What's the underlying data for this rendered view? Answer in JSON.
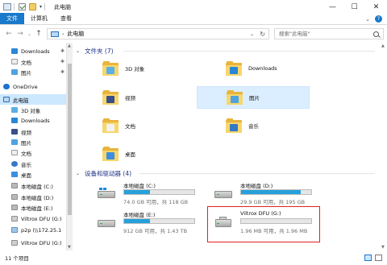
{
  "window": {
    "title": "此电脑",
    "minimize": "—",
    "maximize": "☐",
    "close": "✕"
  },
  "ribbon": {
    "file_tab": "文件",
    "tabs": [
      "计算机",
      "查看"
    ],
    "expand_chevron": "⌄",
    "help": "?"
  },
  "address": {
    "path": "此电脑",
    "separator": "›",
    "dropdown": "⌄",
    "refresh": "↻",
    "back": "←",
    "forward": "→",
    "recent": "⌄",
    "up": "↑"
  },
  "search": {
    "placeholder": "搜索\"此电脑\""
  },
  "nav_pane": {
    "items": [
      {
        "label": "Downloads",
        "pinned": true,
        "icon": "download-icon"
      },
      {
        "label": "文档",
        "pinned": true,
        "icon": "document-icon"
      },
      {
        "label": "图片",
        "pinned": true,
        "icon": "pictures-icon"
      },
      {
        "label": "OneDrive",
        "pinned": false,
        "icon": "onedrive-icon"
      },
      {
        "label": "此电脑",
        "pinned": false,
        "icon": "pc-icon",
        "selected": true
      },
      {
        "label": "3D 对象",
        "pinned": false,
        "icon": "3d-objects-icon"
      },
      {
        "label": "Downloads",
        "pinned": false,
        "icon": "download-icon"
      },
      {
        "label": "视频",
        "pinned": false,
        "icon": "video-icon"
      },
      {
        "label": "图片",
        "pinned": false,
        "icon": "pictures-icon"
      },
      {
        "label": "文档",
        "pinned": false,
        "icon": "document-icon"
      },
      {
        "label": "音乐",
        "pinned": false,
        "icon": "music-icon"
      },
      {
        "label": "桌面",
        "pinned": false,
        "icon": "desktop-icon"
      },
      {
        "label": "本地磁盘 (C:)",
        "pinned": false,
        "icon": "drive-icon"
      },
      {
        "label": "本地磁盘 (D:)",
        "pinned": false,
        "icon": "drive-icon"
      },
      {
        "label": "本地磁盘 (E:)",
        "pinned": false,
        "icon": "drive-icon"
      },
      {
        "label": "Viltrox DFU (G:)",
        "pinned": false,
        "icon": "usb-drive-icon"
      },
      {
        "label": "p2p (\\\\172.25.1",
        "pinned": false,
        "icon": "network-drive-icon"
      },
      {
        "label": "Viltrox DFU (G:)",
        "pinned": false,
        "icon": "usb-drive-icon"
      }
    ],
    "pin_glyph": "✱"
  },
  "folders": {
    "header": "文件夹 (7)",
    "chevron": "⌄",
    "items": [
      {
        "label": "3D 对象",
        "badge_color": "#5ab0e6"
      },
      {
        "label": "Downloads",
        "badge_color": "#2b86d6"
      },
      {
        "label": "视频",
        "badge_color": "#3a4f8a"
      },
      {
        "label": "图片",
        "badge_color": "#4fa3e0",
        "selected": true
      },
      {
        "label": "文档",
        "badge_color": "#f2f2f2"
      },
      {
        "label": "音乐",
        "badge_color": "#3578c4"
      },
      {
        "label": "桌面",
        "badge_color": "#3d8ee0"
      }
    ]
  },
  "drives": {
    "header": "设备和驱动器 (4)",
    "chevron": "⌄",
    "items": [
      {
        "name": "本地磁盘 (C:)",
        "free_text": "74.0 GB 可用，共 118 GB",
        "used_fraction": 0.37,
        "type": "system"
      },
      {
        "name": "本地磁盘 (D:)",
        "free_text": "29.9 GB 可用，共 195 GB",
        "used_fraction": 0.85,
        "type": "disk"
      },
      {
        "name": "本地磁盘 (E:)",
        "free_text": "912 GB 可用，共 1.43 TB",
        "used_fraction": 0.37,
        "type": "disk"
      },
      {
        "name": "Viltrox DFU (G:)",
        "free_text": "1.96 MB 可用，共 1.96 MB",
        "used_fraction": 0.0,
        "type": "usb",
        "highlighted": true
      }
    ],
    "bar_color": "#26a0da",
    "highlight_color": "#e02020"
  },
  "status": {
    "count": "11 个项目"
  },
  "scroll": {
    "up": "▲",
    "down": "▼"
  }
}
